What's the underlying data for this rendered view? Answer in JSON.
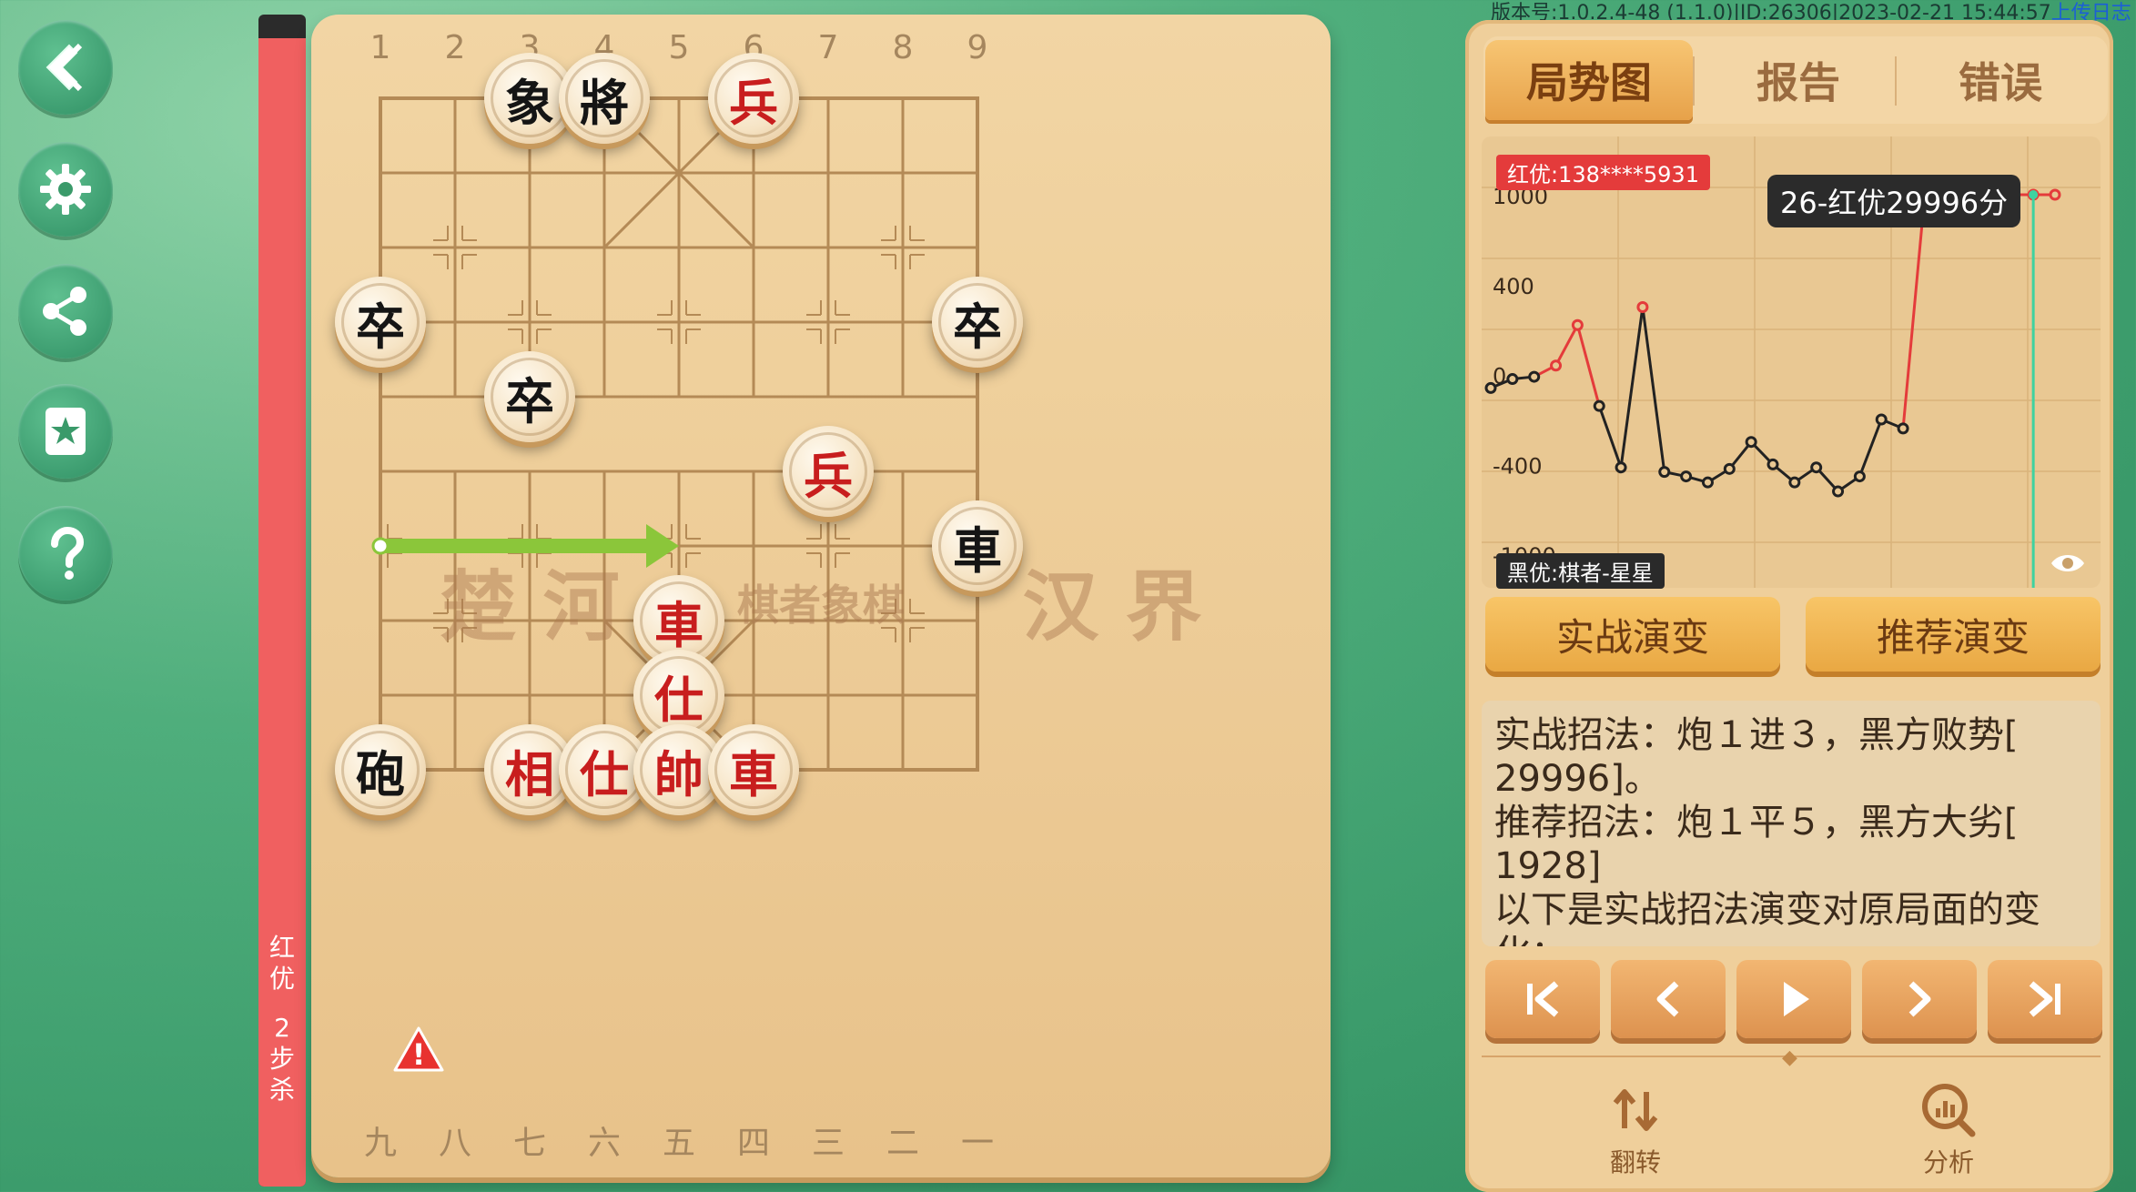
{
  "version_bar": {
    "text": "版本号:1.0.2.4-48 (1.1.0)|ID:26306|2023-02-21 15:44:57",
    "upload_link": "上传日志"
  },
  "sidebar": {
    "items": [
      {
        "name": "back",
        "icon": "back-arrow-icon"
      },
      {
        "name": "settings",
        "icon": "gear-icon"
      },
      {
        "name": "share",
        "icon": "share-icon"
      },
      {
        "name": "favorite",
        "icon": "star-bookmark-icon"
      },
      {
        "name": "help",
        "icon": "question-icon"
      }
    ]
  },
  "eval_bar": {
    "label_line1": "红",
    "label_line2": "优",
    "label_line3": "2",
    "label_line4": "步",
    "label_line5": "杀",
    "red_fraction": 0.98
  },
  "board": {
    "top_file_labels": [
      "1",
      "2",
      "3",
      "4",
      "5",
      "6",
      "7",
      "8",
      "9"
    ],
    "bottom_file_labels": [
      "九",
      "八",
      "七",
      "六",
      "五",
      "四",
      "三",
      "二",
      "一"
    ],
    "river_text_left": "楚 河",
    "river_text_center": "棋者象棋",
    "river_text_right": "汉 界",
    "pieces": [
      {
        "char": "象",
        "side": "black",
        "file": 3,
        "rank": 0
      },
      {
        "char": "將",
        "side": "black",
        "file": 4,
        "rank": 0
      },
      {
        "char": "兵",
        "side": "red",
        "file": 6,
        "rank": 0
      },
      {
        "char": "卒",
        "side": "black",
        "file": 1,
        "rank": 3
      },
      {
        "char": "卒",
        "side": "black",
        "file": 9,
        "rank": 3
      },
      {
        "char": "卒",
        "side": "black",
        "file": 3,
        "rank": 4
      },
      {
        "char": "兵",
        "side": "red",
        "file": 7,
        "rank": 5
      },
      {
        "char": "車",
        "side": "black",
        "file": 9,
        "rank": 6
      },
      {
        "char": "車",
        "side": "red",
        "file": 5,
        "rank": 7
      },
      {
        "char": "仕",
        "side": "red",
        "file": 5,
        "rank": 8
      },
      {
        "char": "砲",
        "side": "black",
        "file": 1,
        "rank": 9
      },
      {
        "char": "相",
        "side": "red",
        "file": 3,
        "rank": 9
      },
      {
        "char": "仕",
        "side": "red",
        "file": 4,
        "rank": 9
      },
      {
        "char": "帥",
        "side": "red",
        "file": 5,
        "rank": 9
      },
      {
        "char": "車",
        "side": "red",
        "file": 6,
        "rank": 9
      }
    ],
    "move_arrow": {
      "from_file": 1,
      "to_file": 5,
      "rank": 6,
      "color": "#8bc63a"
    },
    "warning_mark": "!"
  },
  "tabs": [
    {
      "label": "局势图",
      "active": true
    },
    {
      "label": "报告",
      "active": false
    },
    {
      "label": "错误",
      "active": false
    }
  ],
  "chart_data": {
    "type": "line",
    "red_badge": "红优:138****5931",
    "black_badge": "黑优:棋者-星星",
    "tooltip": "26-红优29996分",
    "y_ticks": [
      "1000",
      "400",
      "0",
      "-400",
      "-1000"
    ],
    "ylim": [
      -1600,
      1600
    ],
    "x": [
      1,
      2,
      3,
      4,
      5,
      6,
      7,
      8,
      9,
      10,
      11,
      12,
      13,
      14,
      15,
      16,
      17,
      18,
      19,
      20,
      21,
      22,
      23,
      24,
      25,
      26,
      27
    ],
    "values": [
      -60,
      -20,
      -10,
      40,
      220,
      -140,
      -420,
      300,
      -450,
      -480,
      -520,
      -430,
      -300,
      -400,
      -520,
      -420,
      -580,
      -480,
      -200,
      -240,
      1000,
      1000,
      1000,
      1000,
      1000,
      1000,
      1000
    ],
    "red_color": "#e43b3b",
    "black_color": "#222222",
    "cursor_color": "#3fd2a0",
    "cursor_index": 26
  },
  "buttons": {
    "actual_variation": "实战演变",
    "recommended_variation": "推荐演变"
  },
  "analysis": {
    "line1": "实战招法：炮１进３，黑方败势[",
    "line2": "29996]。",
    "line3": "推荐招法：炮１平５，黑方大劣[",
    "line4": "1928]",
    "line5": "以下是实战招法演变对原局面的变",
    "line6": "化："
  },
  "nav": {
    "icons": [
      "first-icon",
      "prev-icon",
      "play-icon",
      "next-icon",
      "last-icon"
    ]
  },
  "tools": {
    "flip_label": "翻转",
    "analyze_label": "分析"
  }
}
